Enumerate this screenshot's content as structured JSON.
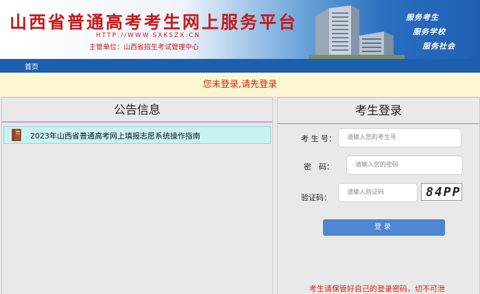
{
  "header": {
    "title": "山西省普通高考考生网上服务平台",
    "url": "HTTP://WWW.SXKSZX.CN",
    "authority": "主管单位：山西省招生考试管理中心",
    "slogans": [
      "服务考生",
      "服务学校",
      "服务社会"
    ]
  },
  "nav": {
    "home": "首页"
  },
  "alert": {
    "message": "您未登录,请先登录"
  },
  "announcements": {
    "title": "公告信息",
    "items": [
      {
        "text": "2023年山西省普通高考网上填报志愿系统操作指南",
        "icon": "book-icon"
      }
    ]
  },
  "login": {
    "title": "考生登录",
    "exam_no_label": "考 生 号：",
    "exam_no_placeholder": "请输入您的考生号",
    "password_label": "密　码：",
    "password_placeholder": "请输入您的密码",
    "captcha_label": "验证码：",
    "captcha_placeholder": "请输入验证码",
    "captcha_text": "84PP",
    "button": "登录",
    "warning": "考生请保管好自己的登录密码，切不可泄"
  },
  "colors": {
    "title_red": "#c41a1a",
    "nav_blue": "#1c5fae",
    "alert_bg": "#fdf6d3",
    "button_blue": "#4d86d2",
    "notice_bg": "#c8f2f6"
  }
}
